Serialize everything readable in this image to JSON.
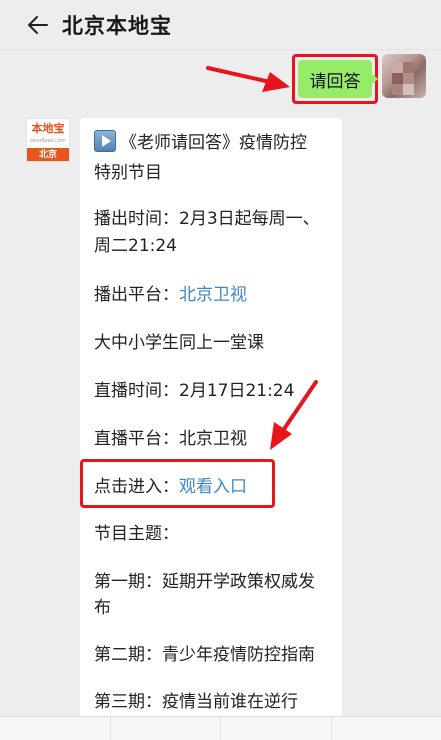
{
  "header": {
    "title": "北京本地宝"
  },
  "chat": {
    "my_message": "请回答",
    "bot_avatar": {
      "logo_text": "本地宝",
      "logo_url": "bendibao.com",
      "city": "北京"
    },
    "bot_message": {
      "lines": [
        "《老师请回答》疫情防控",
        "特别节目",
        "播出时间：2月3日起每周一、",
        "周二21:24",
        "播出平台：",
        "北京卫视",
        "大中小学生同上一堂课",
        "直播时间：2月17日21:24",
        "直播平台：北京卫视",
        "点击进入：",
        "观看入口",
        "节目主题：",
        "第一期：延期开学政策权威发",
        "布",
        "第二期：青少年疫情防控指南",
        "第三期：疫情当前谁在逆行"
      ]
    }
  },
  "colors": {
    "accent_red": "#e8141b",
    "my_bubble_green": "#95ec69",
    "link_blue": "#3f87c3"
  },
  "icons": {
    "back": "arrow-left-icon",
    "play": "play-icon"
  }
}
